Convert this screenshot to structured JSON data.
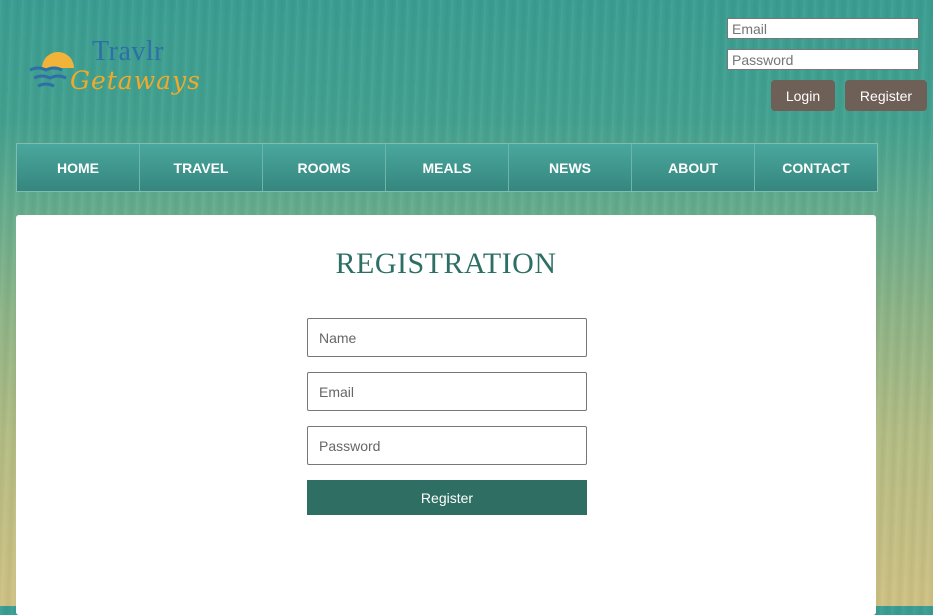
{
  "logo": {
    "title": "Travlr",
    "subtitle": "Getaways",
    "colors": {
      "title": "#2f6fa8",
      "subtitle": "#efaa2c",
      "sun": "#f2b33a",
      "birds": "#2f6fa8"
    }
  },
  "header_login": {
    "email_placeholder": "Email",
    "password_placeholder": "Password",
    "login_label": "Login",
    "register_label": "Register",
    "button_color": "#6e5f57"
  },
  "nav": {
    "items": [
      "HOME",
      "TRAVEL",
      "ROOMS",
      "MEALS",
      "NEWS",
      "ABOUT",
      "CONTACT"
    ]
  },
  "registration": {
    "title": "REGISTRATION",
    "name_placeholder": "Name",
    "email_placeholder": "Email",
    "password_placeholder": "Password",
    "submit_label": "Register",
    "accent": "#2f6e62"
  }
}
